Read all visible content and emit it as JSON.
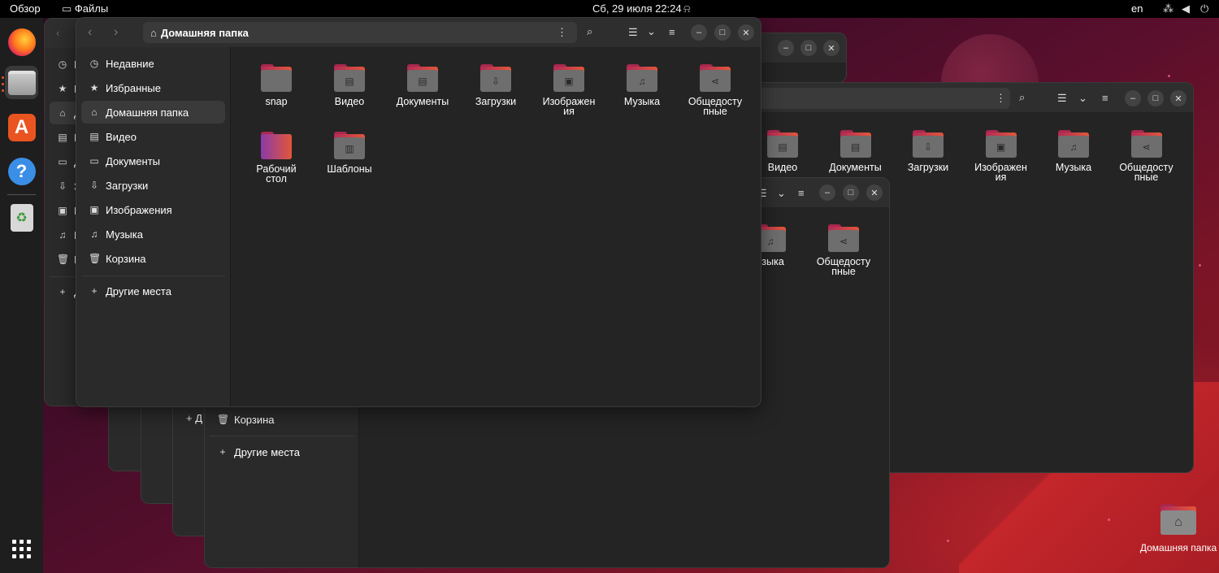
{
  "topbar": {
    "overview": "Обзор",
    "app_name": "Файлы",
    "clock": "Сб, 29 июля  22:24",
    "lang": "en"
  },
  "front_window": {
    "path": "Домашняя папка",
    "sidebar": [
      {
        "label": "Недавние",
        "icon": "clock-icon"
      },
      {
        "label": "Избранные",
        "icon": "star-icon"
      },
      {
        "label": "Домашняя папка",
        "icon": "home-icon",
        "active": true
      },
      {
        "label": "Видео",
        "icon": "video-icon"
      },
      {
        "label": "Документы",
        "icon": "document-icon"
      },
      {
        "label": "Загрузки",
        "icon": "download-icon"
      },
      {
        "label": "Изображения",
        "icon": "image-icon"
      },
      {
        "label": "Музыка",
        "icon": "music-icon"
      },
      {
        "label": "Корзина",
        "icon": "trash-icon"
      }
    ],
    "other_places": "Другие места",
    "folders": [
      {
        "l1": "snap",
        "l2": ""
      },
      {
        "l1": "Видео",
        "l2": ""
      },
      {
        "l1": "Документы",
        "l2": ""
      },
      {
        "l1": "Загрузки",
        "l2": ""
      },
      {
        "l1": "Изображен",
        "l2": "ия"
      },
      {
        "l1": "Музыка",
        "l2": ""
      },
      {
        "l1": "Общедосту",
        "l2": "пные"
      },
      {
        "l1": "Рабочий",
        "l2": "стол"
      },
      {
        "l1": "Шаблоны",
        "l2": ""
      }
    ]
  },
  "back_window_b": {
    "folders": [
      {
        "l1": "Видео",
        "l2": ""
      },
      {
        "l1": "Документы",
        "l2": ""
      },
      {
        "l1": "Загрузки",
        "l2": ""
      },
      {
        "l1": "Изображен",
        "l2": "ия"
      },
      {
        "l1": "Музыка",
        "l2": ""
      },
      {
        "l1": "Общедосту",
        "l2": "пные"
      }
    ]
  },
  "back_window_c": {
    "folders": [
      {
        "l1": "узыка",
        "l2": ""
      },
      {
        "l1": "Общедосту",
        "l2": "пные"
      }
    ]
  },
  "stack_window": {
    "trash": "Корзина",
    "other_places": "Другие места"
  },
  "left_stub": {
    "letters": [
      "Н",
      "И",
      "Д",
      "В",
      "Д",
      "З",
      "И",
      "М",
      "К"
    ],
    "plus": "Д"
  },
  "desktop": {
    "home_label": "Домашняя папка"
  }
}
